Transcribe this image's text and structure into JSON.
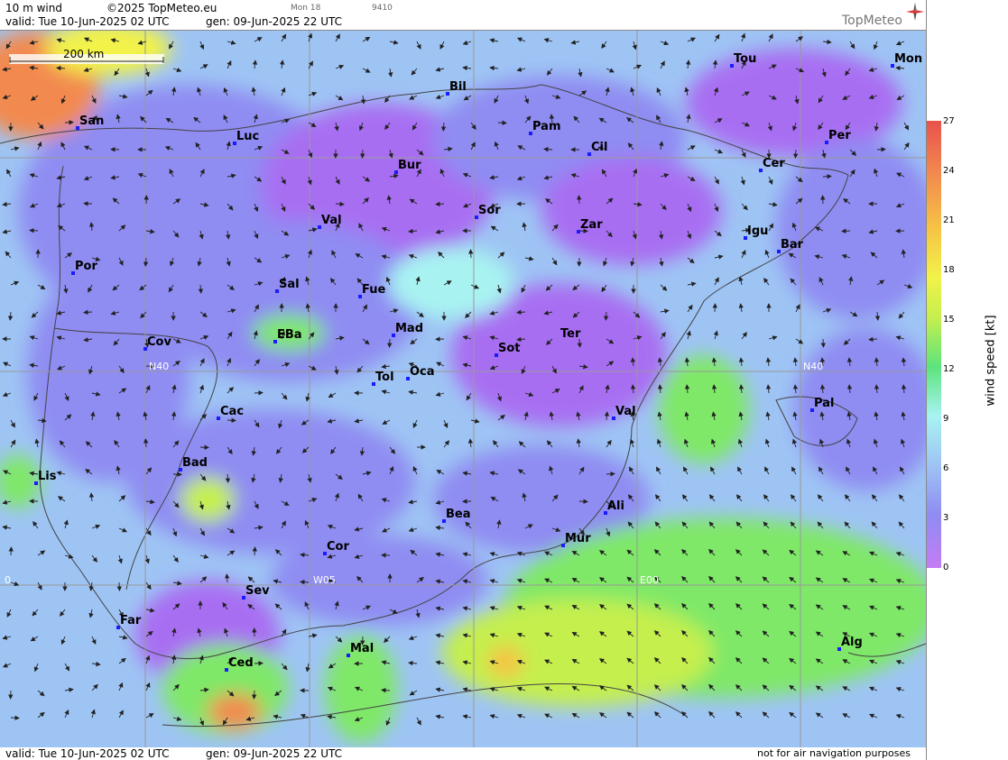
{
  "header": {
    "product": "10 m wind",
    "copyright": "©2025 TopMeteo.eu",
    "small1": "Mon 18",
    "small2": "9410",
    "valid": "valid:  Tue  10-Jun-2025  02 UTC",
    "gen": "gen: 09-Jun-2025 22 UTC",
    "brand": "TopMeteo"
  },
  "footer": {
    "valid": "valid:  Tue  10-Jun-2025  02 UTC",
    "gen": "gen: 09-Jun-2025 22 UTC",
    "note": "not for air navigation purposes"
  },
  "scale_bar": "200 km",
  "grid_labels": [
    "N40",
    "N40",
    "W05",
    "E00",
    "0"
  ],
  "cities": [
    {
      "name": "San"
    },
    {
      "name": "Luc"
    },
    {
      "name": "Bil"
    },
    {
      "name": "Pam"
    },
    {
      "name": "Cil"
    },
    {
      "name": "Tou"
    },
    {
      "name": "Mon"
    },
    {
      "name": "Per"
    },
    {
      "name": "Cer"
    },
    {
      "name": "Bur"
    },
    {
      "name": "Val"
    },
    {
      "name": "Sor"
    },
    {
      "name": "Zar"
    },
    {
      "name": "Igu"
    },
    {
      "name": "Bar"
    },
    {
      "name": "Por"
    },
    {
      "name": "Sal"
    },
    {
      "name": "Fue"
    },
    {
      "name": "Mad"
    },
    {
      "name": "EBa"
    },
    {
      "name": "Cov"
    },
    {
      "name": "Sot"
    },
    {
      "name": "Ter"
    },
    {
      "name": "Tol"
    },
    {
      "name": "Oca"
    },
    {
      "name": "Cac"
    },
    {
      "name": "Val"
    },
    {
      "name": "Pal"
    },
    {
      "name": "Bad"
    },
    {
      "name": "Lis"
    },
    {
      "name": "Bea"
    },
    {
      "name": "Ali"
    },
    {
      "name": "Mur"
    },
    {
      "name": "Cor"
    },
    {
      "name": "Sev"
    },
    {
      "name": "Far"
    },
    {
      "name": "Mal"
    },
    {
      "name": "Ced"
    },
    {
      "name": "Alg"
    }
  ],
  "colorbar": {
    "title": "wind speed [kt]",
    "ticks": [
      "27",
      "24",
      "21",
      "18",
      "15",
      "12",
      "9",
      "6",
      "3",
      "0"
    ],
    "colors": [
      "#e8524c",
      "#f28a4f",
      "#f6c345",
      "#f2f24a",
      "#c5ef4e",
      "#7fe868",
      "#5ce47c",
      "#a8f3f2",
      "#9ec4f4",
      "#8f8cf2",
      "#a86ef2",
      "#c47cf4"
    ]
  }
}
